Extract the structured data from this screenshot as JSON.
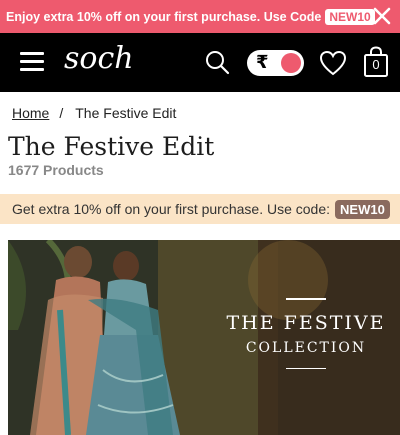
{
  "promo": {
    "text": "Enjoy extra 10% off on your first purchase. Use Code",
    "code": "NEW10"
  },
  "header": {
    "logo": "soch",
    "currency_symbol": "₹",
    "bag_count": "0"
  },
  "breadcrumb": {
    "home": "Home",
    "separator": "/",
    "current": "The Festive Edit"
  },
  "page": {
    "title": "The Festive Edit",
    "product_count": "1677 Products"
  },
  "offer": {
    "text": "Get extra 10% off on your first purchase. Use code:",
    "code": "NEW10"
  },
  "banner": {
    "line1": "THE FESTIVE",
    "line2": "COLLECTION"
  },
  "colors": {
    "promo_bg": "#ee5a6e",
    "header_bg": "#000000",
    "offer_bg": "#fbe4c6",
    "offer_code_bg": "#8a6a5e"
  },
  "icons": [
    "close-icon",
    "menu-icon",
    "search-icon",
    "rupee-icon",
    "heart-icon",
    "bag-icon"
  ]
}
